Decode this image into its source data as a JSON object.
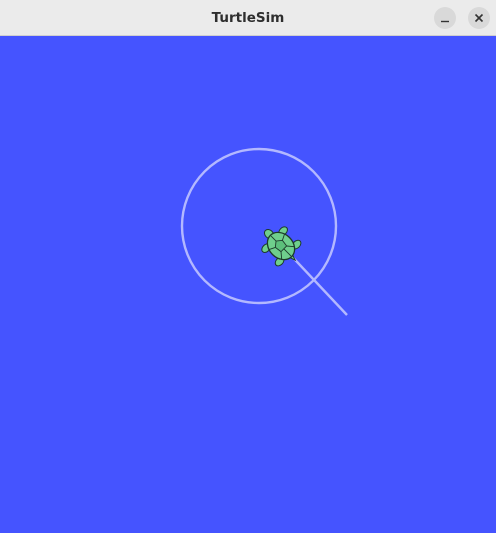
{
  "window": {
    "title": "TurtleSim",
    "controls": {
      "minimize_icon": "minimize-icon",
      "close_icon": "close-icon"
    }
  },
  "canvas": {
    "background_color": "#4554ff",
    "pen_color": "#b3b8ff",
    "turtle_shell_color": "#6fcf8c",
    "turtle_outline_color": "#1d3a2a"
  }
}
